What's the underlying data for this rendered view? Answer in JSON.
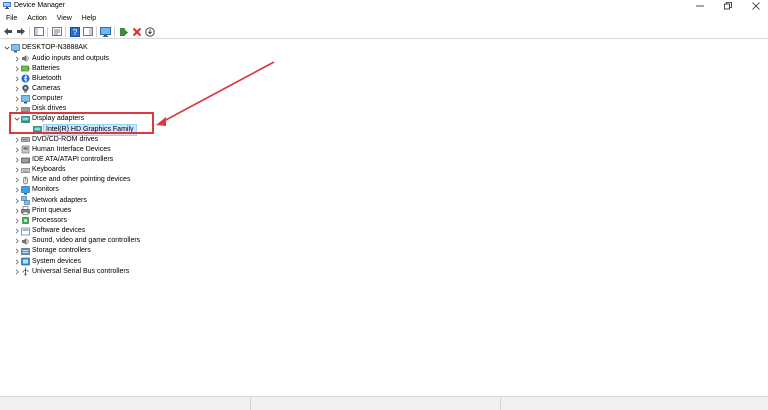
{
  "window": {
    "title": "Device Manager"
  },
  "menu": [
    "File",
    "Action",
    "View",
    "Help"
  ],
  "toolbar": {
    "buttons": [
      "back-icon",
      "forward-icon",
      "console-tree-icon",
      "properties-icon",
      "help-icon",
      "action-pane-icon",
      "monitor-icon",
      "update-driver-icon",
      "uninstall-icon",
      "scan-hardware-icon"
    ]
  },
  "tree": {
    "root": "DESKTOP-N3888AK",
    "categories": [
      {
        "label": "Audio inputs and outputs",
        "icon": "speaker-icon"
      },
      {
        "label": "Batteries",
        "icon": "battery-icon"
      },
      {
        "label": "Bluetooth",
        "icon": "bluetooth-icon"
      },
      {
        "label": "Cameras",
        "icon": "camera-icon"
      },
      {
        "label": "Computer",
        "icon": "computer-icon"
      },
      {
        "label": "Disk drives",
        "icon": "disk-icon"
      },
      {
        "label": "Display adapters",
        "icon": "display-adapter-icon",
        "expanded": true,
        "children": [
          {
            "label": "Intel(R) HD Graphics Family",
            "icon": "display-adapter-icon",
            "selected": true
          }
        ]
      },
      {
        "label": "DVD/CD-ROM drives",
        "icon": "dvd-icon"
      },
      {
        "label": "Human Interface Devices",
        "icon": "hid-icon"
      },
      {
        "label": "IDE ATA/ATAPI controllers",
        "icon": "ide-icon"
      },
      {
        "label": "Keyboards",
        "icon": "keyboard-icon"
      },
      {
        "label": "Mice and other pointing devices",
        "icon": "mouse-icon"
      },
      {
        "label": "Monitors",
        "icon": "monitor-icon"
      },
      {
        "label": "Network adapters",
        "icon": "network-icon"
      },
      {
        "label": "Print queues",
        "icon": "printer-icon"
      },
      {
        "label": "Processors",
        "icon": "processor-icon"
      },
      {
        "label": "Software devices",
        "icon": "software-device-icon"
      },
      {
        "label": "Sound, video and game controllers",
        "icon": "sound-icon"
      },
      {
        "label": "Storage controllers",
        "icon": "storage-icon"
      },
      {
        "label": "System devices",
        "icon": "system-icon"
      },
      {
        "label": "Universal Serial Bus controllers",
        "icon": "usb-icon"
      }
    ]
  },
  "colors": {
    "annotation": "#d9383f",
    "selection": "#cce8ff"
  }
}
